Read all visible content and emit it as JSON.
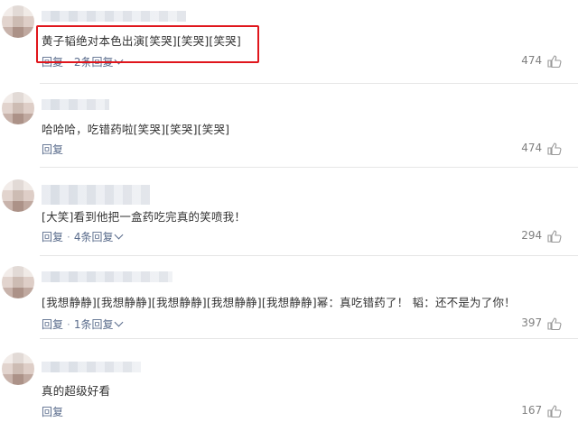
{
  "comments": [
    {
      "text": "黄子韬绝对本色出演[笑哭][笑哭][笑哭]",
      "reply": "回复",
      "replies": "2条回复",
      "likes": "474"
    },
    {
      "text": "哈哈哈，吃错药啦[笑哭][笑哭][笑哭]",
      "reply": "回复",
      "replies": "",
      "likes": "474"
    },
    {
      "text": "[大笑]看到他把一盒药吃完真的笑喷我！",
      "reply": "回复",
      "replies": "4条回复",
      "likes": "294"
    },
    {
      "text": "[我想静静][我想静静][我想静静][我想静静][我想静静]幂：真吃错药了！ 韬：还不是为了你！",
      "reply": "回复",
      "replies": "1条回复",
      "likes": "397"
    },
    {
      "text": "真的超级好看",
      "reply": "回复",
      "replies": "",
      "likes": "167"
    }
  ],
  "reply_separator": "·",
  "highlight_color": "#e0161c",
  "link_color": "#5a6c8c",
  "icons": {
    "like": "thumbs-up-icon",
    "expand": "chevron-down-icon"
  }
}
